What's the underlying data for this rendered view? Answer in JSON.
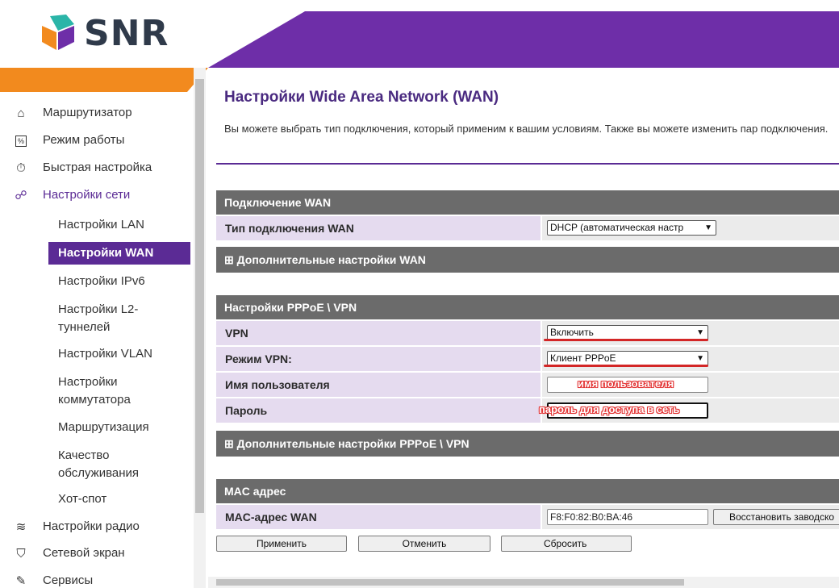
{
  "brand": {
    "name": "SNR",
    "purple": "#6e2ea8",
    "orange": "#f28a1e"
  },
  "sidebar": {
    "items": [
      {
        "icon": "router-icon",
        "label": "Маршрутизатор"
      },
      {
        "icon": "mode-icon",
        "label": "Режим работы"
      },
      {
        "icon": "stopwatch-icon",
        "label": "Быстрая настройка"
      },
      {
        "icon": "network-icon",
        "label": "Настройки сети"
      }
    ],
    "subitems": [
      "Настройки LAN",
      "Настройки WAN",
      "Настройки IPv6",
      "Настройки L2-туннелей",
      "Настройки VLAN",
      "Настройки коммутатора",
      "Маршрутизация",
      "Качество обслуживания",
      "Хот-спот"
    ],
    "subitems_lines": {
      "l2a": "Настройки L2-",
      "l2b": "туннелей",
      "swa": "Настройки",
      "swb": "коммутатора",
      "qosa": "Качество",
      "qosb": "обслуживания"
    },
    "active_subitem": "Настройки WAN",
    "items_bottom": [
      {
        "icon": "wifi-icon",
        "label": "Настройки радио"
      },
      {
        "icon": "shield-icon",
        "label": "Сетевой экран"
      },
      {
        "icon": "wrench-icon",
        "label": "Сервисы"
      }
    ]
  },
  "page": {
    "title": "Настройки Wide Area Network (WAN)",
    "description": "Вы можете выбрать тип подключения, который применим к вашим условиям. Также вы можете изменить пар подключения."
  },
  "wan": {
    "header": "Подключение WAN",
    "type_label": "Тип подключения WAN",
    "type_value": "DHCP (автоматическая настр",
    "advanced": "⊞ Дополнительные настройки WAN"
  },
  "pppoe": {
    "header": "Настройки PPPoE \\ VPN",
    "vpn_label": "VPN",
    "vpn_value": "Включить",
    "mode_label": "Режим VPN:",
    "mode_value": "Клиент PPPoE",
    "user_label": "Имя пользователя",
    "user_annotation": "имя пользователя",
    "pass_label": "Пароль",
    "pass_annotation": "пароль для доступа в сеть",
    "advanced": "⊞ Дополнительные настройки PPPoE \\ VPN"
  },
  "mac": {
    "header": "MAC адрес",
    "label": "MAC-адрес WAN",
    "value": "F8:F0:82:B0:BA:46",
    "restore_button": "Восстановить заводско"
  },
  "actions": {
    "apply": "Применить",
    "cancel": "Отменить",
    "reset": "Сбросить"
  }
}
